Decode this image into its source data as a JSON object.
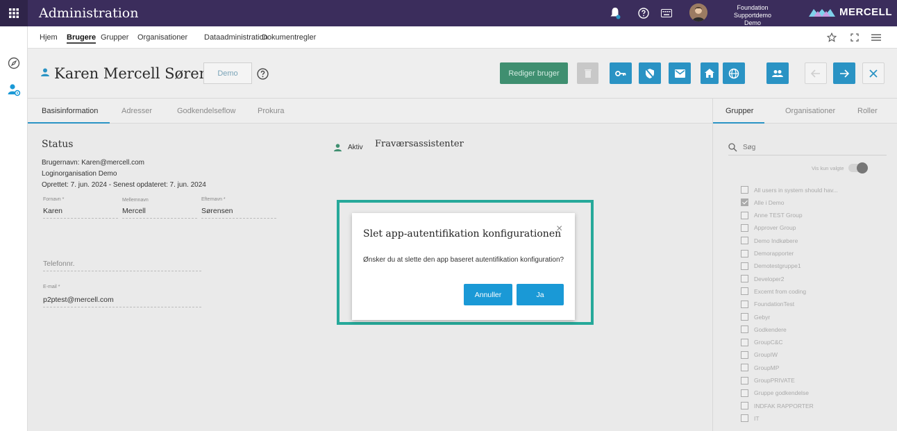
{
  "app": {
    "title": "Administration",
    "user_line1": "Foundation Supportdemo",
    "user_line2": "Demo",
    "logo": "MERCELL"
  },
  "menu": {
    "items": [
      "Hjem",
      "Brugere",
      "Grupper",
      "Organisationer",
      "Dataadministration",
      "Dokumentregler"
    ],
    "active": "Brugere"
  },
  "person": {
    "name": "Karen Mercell Sørensen",
    "org_chip": "Demo",
    "edit_label": "Rediger bruger"
  },
  "tabs_left": [
    "Basisinformation",
    "Adresser",
    "Godkendelseflow",
    "Prokura"
  ],
  "tabs_right": [
    "Grupper",
    "Organisationer",
    "Roller"
  ],
  "status": {
    "title": "Status",
    "username_line": "Brugernavn: Karen@mercell.com",
    "login_org_line": "Loginorganisation Demo",
    "dates_line": "Oprettet: 7. jun. 2024 - Senest opdateret: 7. jun. 2024",
    "aktiv": "Aktiv",
    "fravaer_title": "Fraværsassistenter"
  },
  "fields": {
    "fornavn_label": "Fornavn *",
    "fornavn_value": "Karen",
    "mellemnavn_label": "Mellemnavn",
    "mellemnavn_value": "Mercell",
    "efternavn_label": "Efternavn *",
    "efternavn_value": "Sørensen",
    "telefon_placeholder": "Telefonnr.",
    "email_label": "E-mail *",
    "email_value": "p2ptest@mercell.com"
  },
  "groups_panel": {
    "search_placeholder": "Søg",
    "vis_kun_valgte": "Vis kun valgte",
    "items": [
      {
        "label": "All users in system should hav...",
        "checked": false
      },
      {
        "label": "Alle i Demo",
        "checked": true
      },
      {
        "label": "Anne TEST Group",
        "checked": false
      },
      {
        "label": "Approver Group",
        "checked": false
      },
      {
        "label": "Demo Indkøbere",
        "checked": false
      },
      {
        "label": "Demorapporter",
        "checked": false
      },
      {
        "label": "Demotestgruppe1",
        "checked": false
      },
      {
        "label": "Developer2",
        "checked": false
      },
      {
        "label": "Excemt from coding",
        "checked": false
      },
      {
        "label": "FoundationTest",
        "checked": false
      },
      {
        "label": "Gebyr",
        "checked": false
      },
      {
        "label": "Godkendere",
        "checked": false
      },
      {
        "label": "GroupC&C",
        "checked": false
      },
      {
        "label": "GroupIW",
        "checked": false
      },
      {
        "label": "GroupMP",
        "checked": false
      },
      {
        "label": "GroupPRIVATE",
        "checked": false
      },
      {
        "label": "Gruppe godkendelse",
        "checked": false
      },
      {
        "label": "INDFAK RAPPORTER",
        "checked": false
      },
      {
        "label": "IT",
        "checked": false
      }
    ]
  },
  "modal": {
    "title": "Slet app-autentifikation konfigurationen",
    "body": "Ønsker du at slette den app baseret autentifikation konfiguration?",
    "cancel_label": "Annuller",
    "ok_label": "Ja"
  },
  "colors": {
    "topbar": "#3b2d5c",
    "accent_blue": "#2a93c4",
    "edit_green": "#3f8f70",
    "highlight_teal": "#26a99a"
  }
}
